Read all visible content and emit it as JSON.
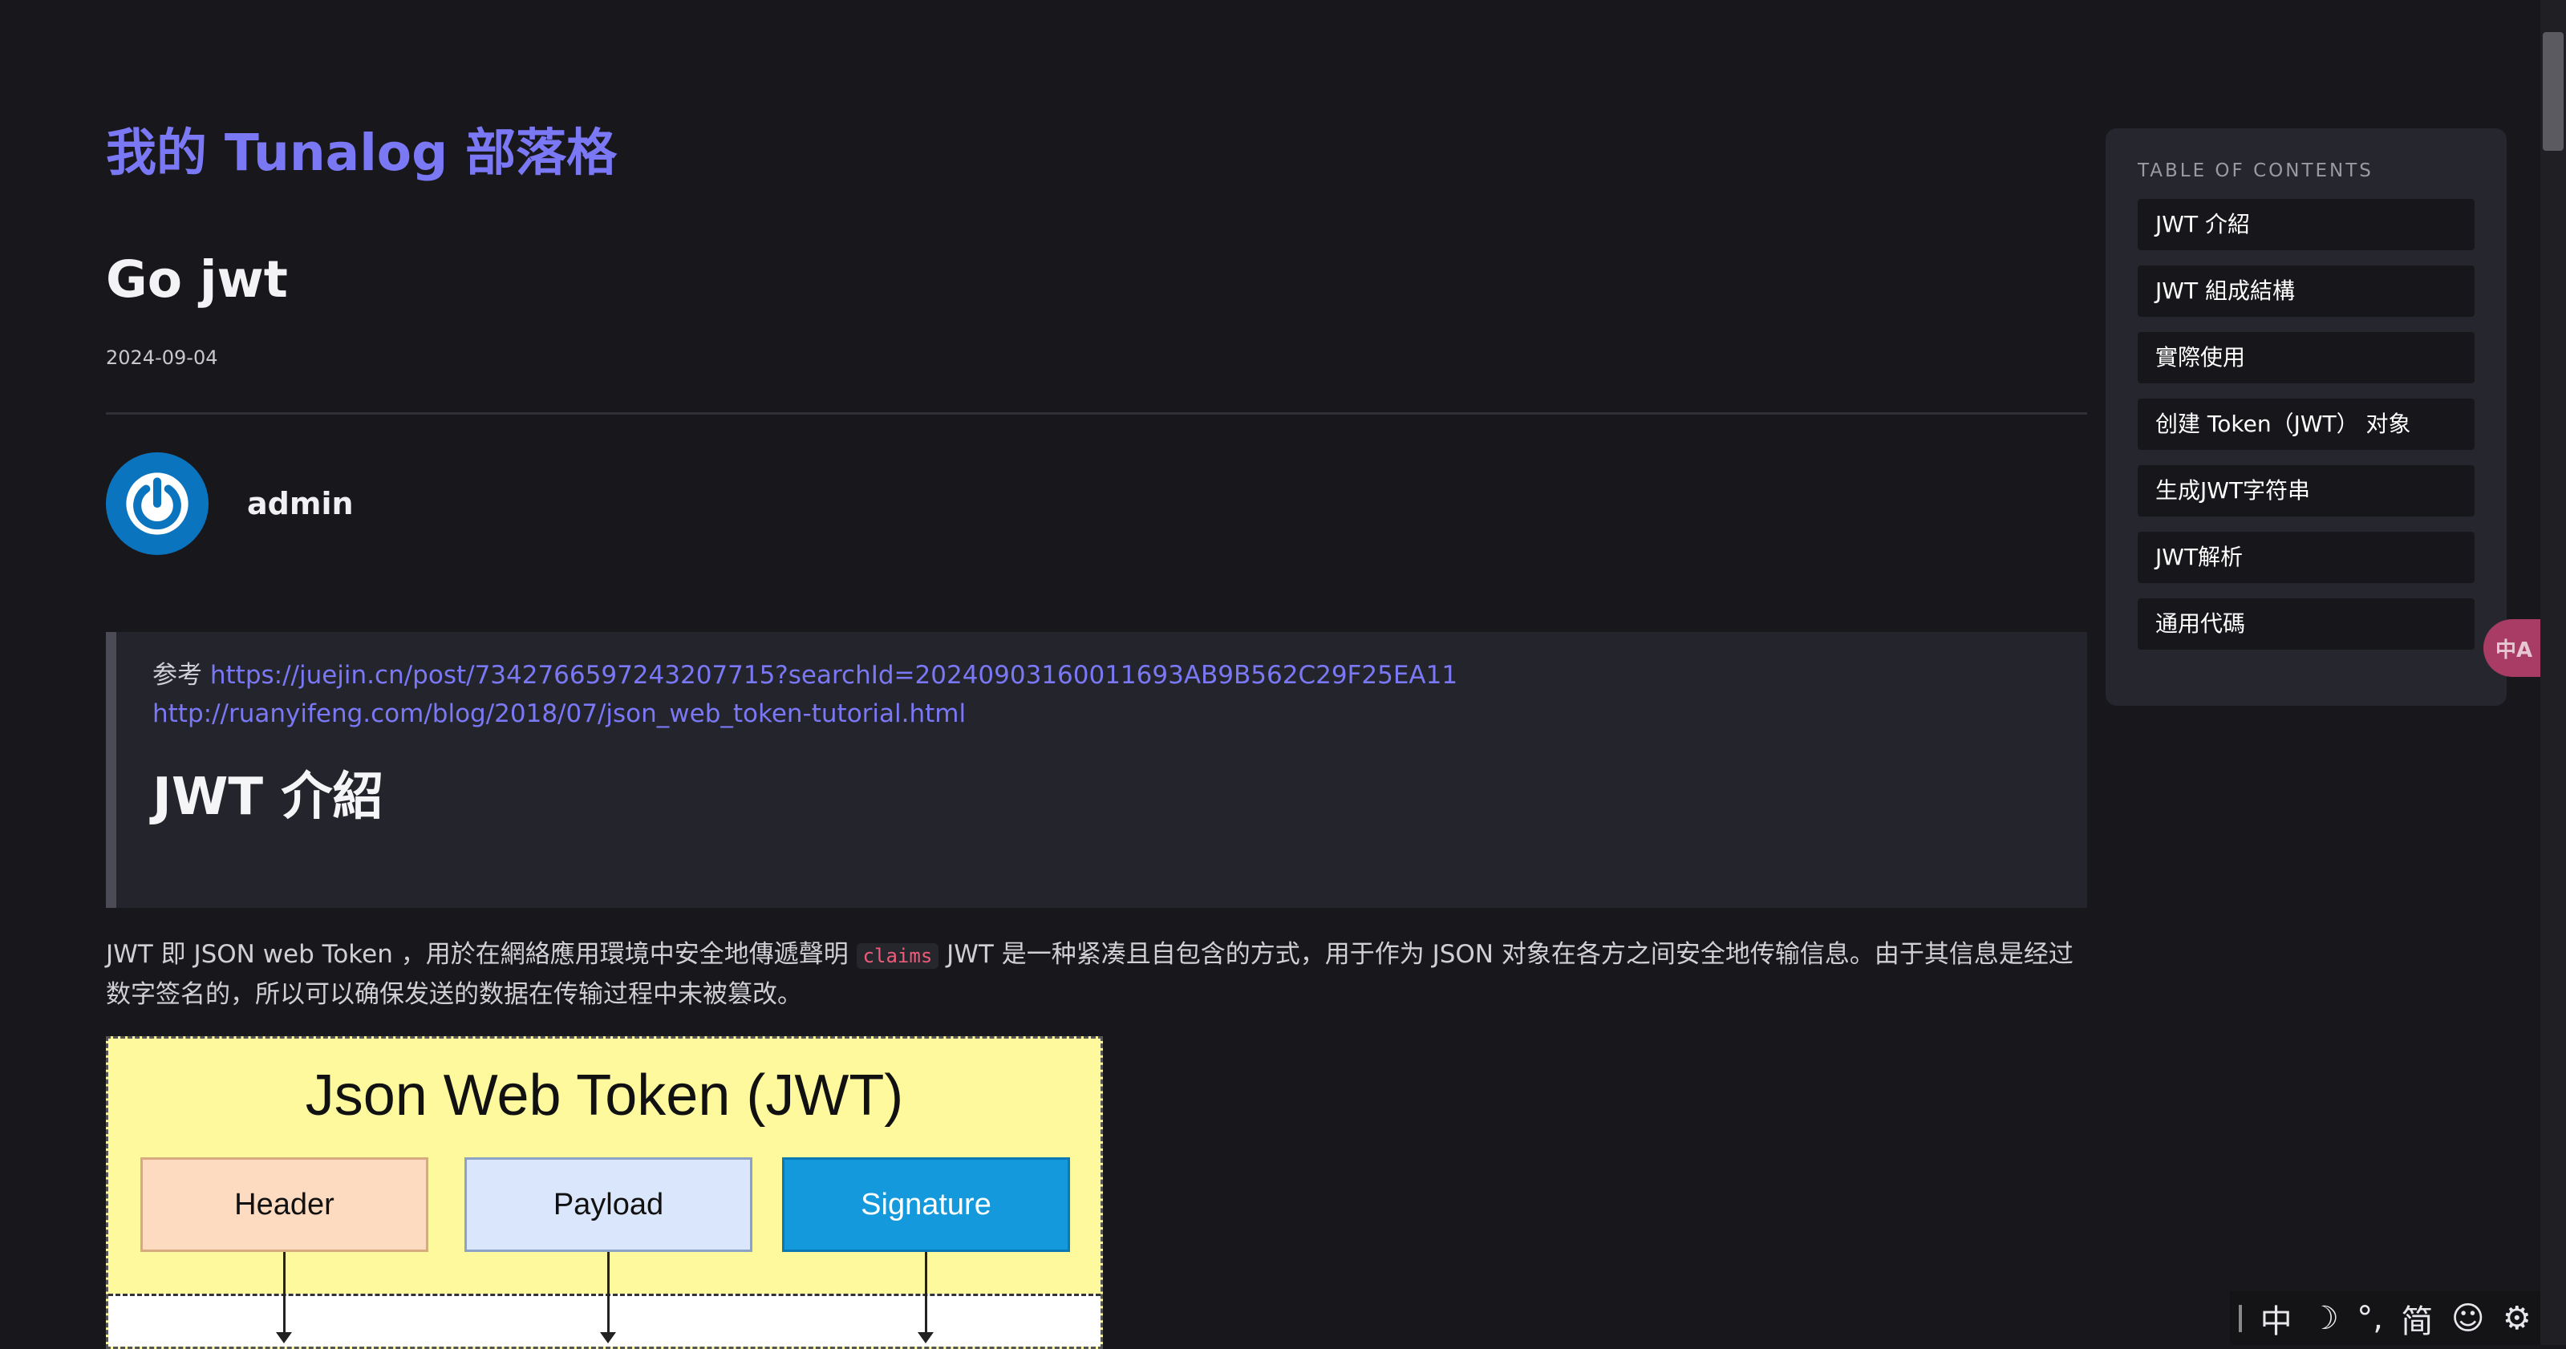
{
  "site": {
    "title": "我的 Tunalog 部落格"
  },
  "post": {
    "title": "Go jwt",
    "date": "2024-09-04",
    "author": "admin"
  },
  "blockquote": {
    "ref_prefix": "参考",
    "link1": "https://juejin.cn/post/7342766597243207715?searchId=20240903160011693AB9B562C29F25EA11",
    "link2": "http://ruanyifeng.com/blog/2018/07/json_web_token-tutorial.html",
    "heading": "JWT 介紹"
  },
  "paragraph": {
    "before": "JWT 即 JSON web Token ，用於在網絡應用環境中安全地傳遞聲明 ",
    "code": "claims",
    "after": " JWT 是一种紧凑且自包含的方式，用于作为 JSON 对象在各方之间安全地传输信息。由于其信息是经过数字签名的，所以可以确保发送的数据在传输过程中未被篡改。"
  },
  "figure": {
    "title": "Json Web Token (JWT)",
    "boxes": [
      "Header",
      "Payload",
      "Signature"
    ]
  },
  "toc": {
    "heading": "TABLE OF CONTENTS",
    "items": [
      "JWT 介紹",
      "JWT 組成結構",
      "實際使用",
      "创建 Token（JWT） 对象",
      "生成JWT字符串",
      "JWT解析",
      "通用代碼"
    ]
  },
  "ime_bar": {
    "items": [
      "中",
      "☽",
      "°,",
      "简",
      "☺",
      "⚙"
    ]
  },
  "translate_button": {
    "label": "中A"
  },
  "colors": {
    "background": "#18181c",
    "accent": "#7b78f5",
    "code": "#ef5b7a"
  }
}
